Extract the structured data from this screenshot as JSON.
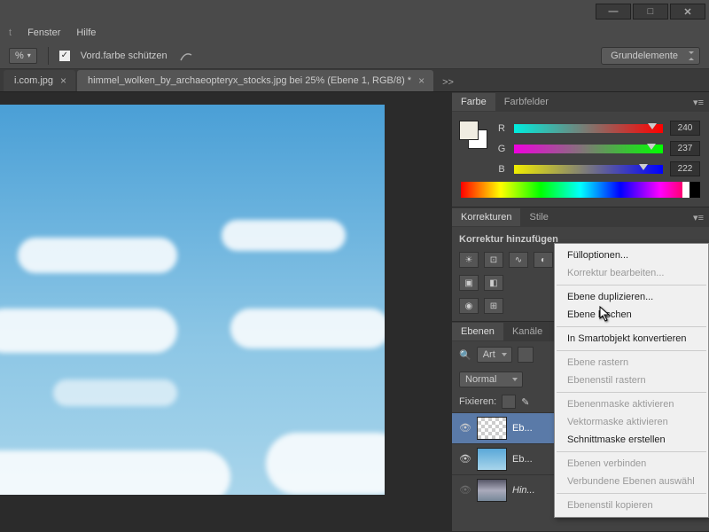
{
  "menu": {
    "fenster": "Fenster",
    "hilfe": "Hilfe"
  },
  "toolbar": {
    "pct_suffix": "%",
    "fg_protect": "Vord.farbe schützen",
    "workspace": "Grundelemente"
  },
  "tabs": {
    "t0": "i.com.jpg",
    "t1": "himmel_wolken_by_archaeopteryx_stocks.jpg bei 25% (Ebene 1, RGB/8) *",
    "overflow": ">>"
  },
  "panels": {
    "farbe": "Farbe",
    "farbfelder": "Farbfelder",
    "korrekturen": "Korrekturen",
    "stile": "Stile",
    "korr_add": "Korrektur hinzufügen",
    "ebenen": "Ebenen",
    "kanaele": "Kanäle"
  },
  "color": {
    "r_label": "R",
    "r_val": "240",
    "g_label": "G",
    "g_val": "237",
    "b_label": "B",
    "b_val": "222"
  },
  "layers_panel": {
    "kind": "Art",
    "blend": "Normal",
    "lock_label": "Fixieren:",
    "items": [
      {
        "name": "Eb..."
      },
      {
        "name": "Eb..."
      },
      {
        "name": "Hin..."
      }
    ]
  },
  "ctx": {
    "i0": "Fülloptionen...",
    "i1": "Korrektur bearbeiten...",
    "i2": "Ebene duplizieren...",
    "i3": "Ebene löschen",
    "i4": "In Smartobjekt konvertieren",
    "i5": "Ebene rastern",
    "i6": "Ebenenstil rastern",
    "i7": "Ebenenmaske aktivieren",
    "i8": "Vektormaske aktivieren",
    "i9": "Schnittmaske erstellen",
    "i10": "Ebenen verbinden",
    "i11": "Verbundene Ebenen auswähl",
    "i12": "Ebenenstil kopieren"
  }
}
